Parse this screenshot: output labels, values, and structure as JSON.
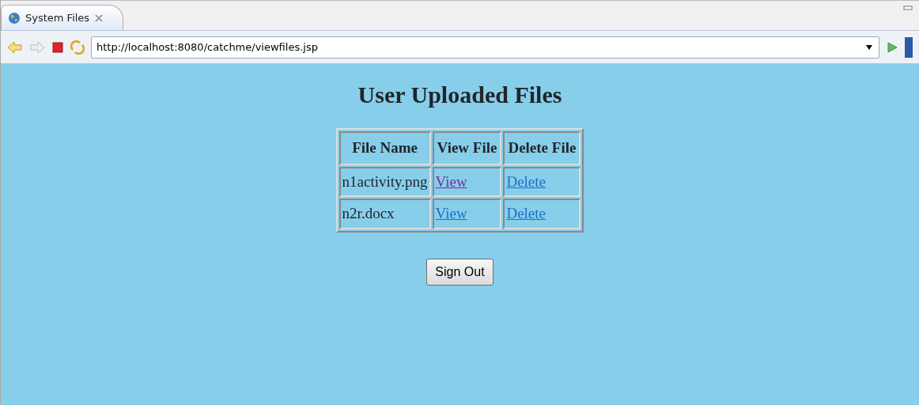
{
  "tab": {
    "title": "System Files"
  },
  "address_bar": {
    "value": "http://localhost:8080/catchme/viewfiles.jsp"
  },
  "page": {
    "heading": "User Uploaded Files",
    "table": {
      "columns": [
        "File Name",
        "View File",
        "Delete File"
      ],
      "rows": [
        {
          "file_name": "n1activity.png",
          "view": {
            "text": "View",
            "visited": true
          },
          "delete": {
            "text": "Delete",
            "visited": false
          }
        },
        {
          "file_name": "n2r.docx",
          "view": {
            "text": "View",
            "visited": false
          },
          "delete": {
            "text": "Delete",
            "visited": false
          }
        }
      ]
    },
    "button": "Sign Out"
  }
}
